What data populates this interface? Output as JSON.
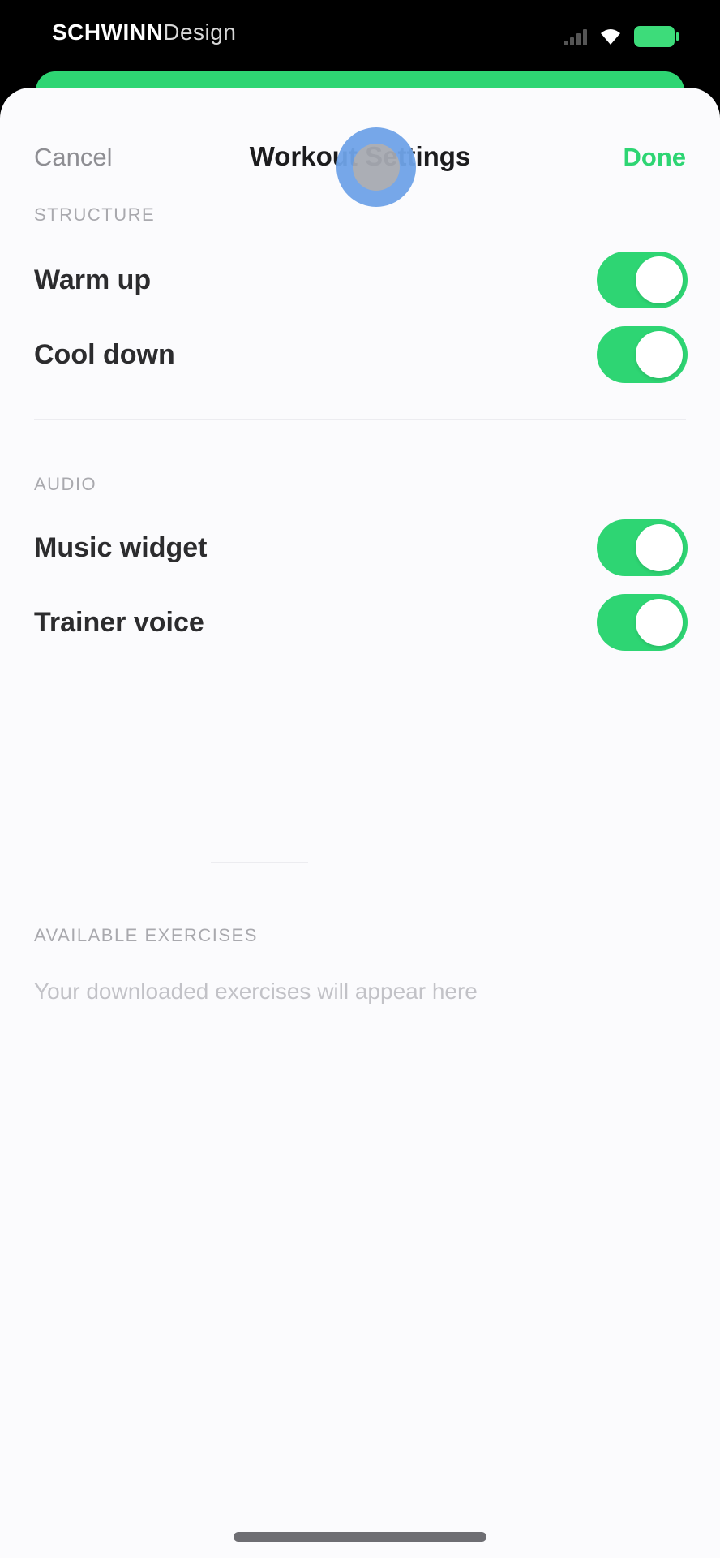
{
  "status_bar": {
    "carrier_bold": "SCHWINN",
    "carrier_sub": "Design",
    "signal_bars": 4,
    "battery_color": "#3ddc7a"
  },
  "nav": {
    "cancel_label": "Cancel",
    "title": "Workout Settings",
    "done_label": "Done"
  },
  "sections": {
    "structure": {
      "header": "STRUCTURE",
      "rows": [
        {
          "label": "Warm up",
          "on": true
        },
        {
          "label": "Cool down",
          "on": true
        }
      ]
    },
    "audio": {
      "header": "AUDIO",
      "rows": [
        {
          "label": "Music widget",
          "on": true
        },
        {
          "label": "Trainer voice",
          "on": true
        }
      ]
    },
    "exercises": {
      "header": "AVAILABLE EXERCISES",
      "empty_text": "Your downloaded exercises will appear here"
    }
  },
  "colors": {
    "accent": "#2ed573",
    "background": "#fbfbfd",
    "touch_indicator": "#6fa3e8"
  }
}
